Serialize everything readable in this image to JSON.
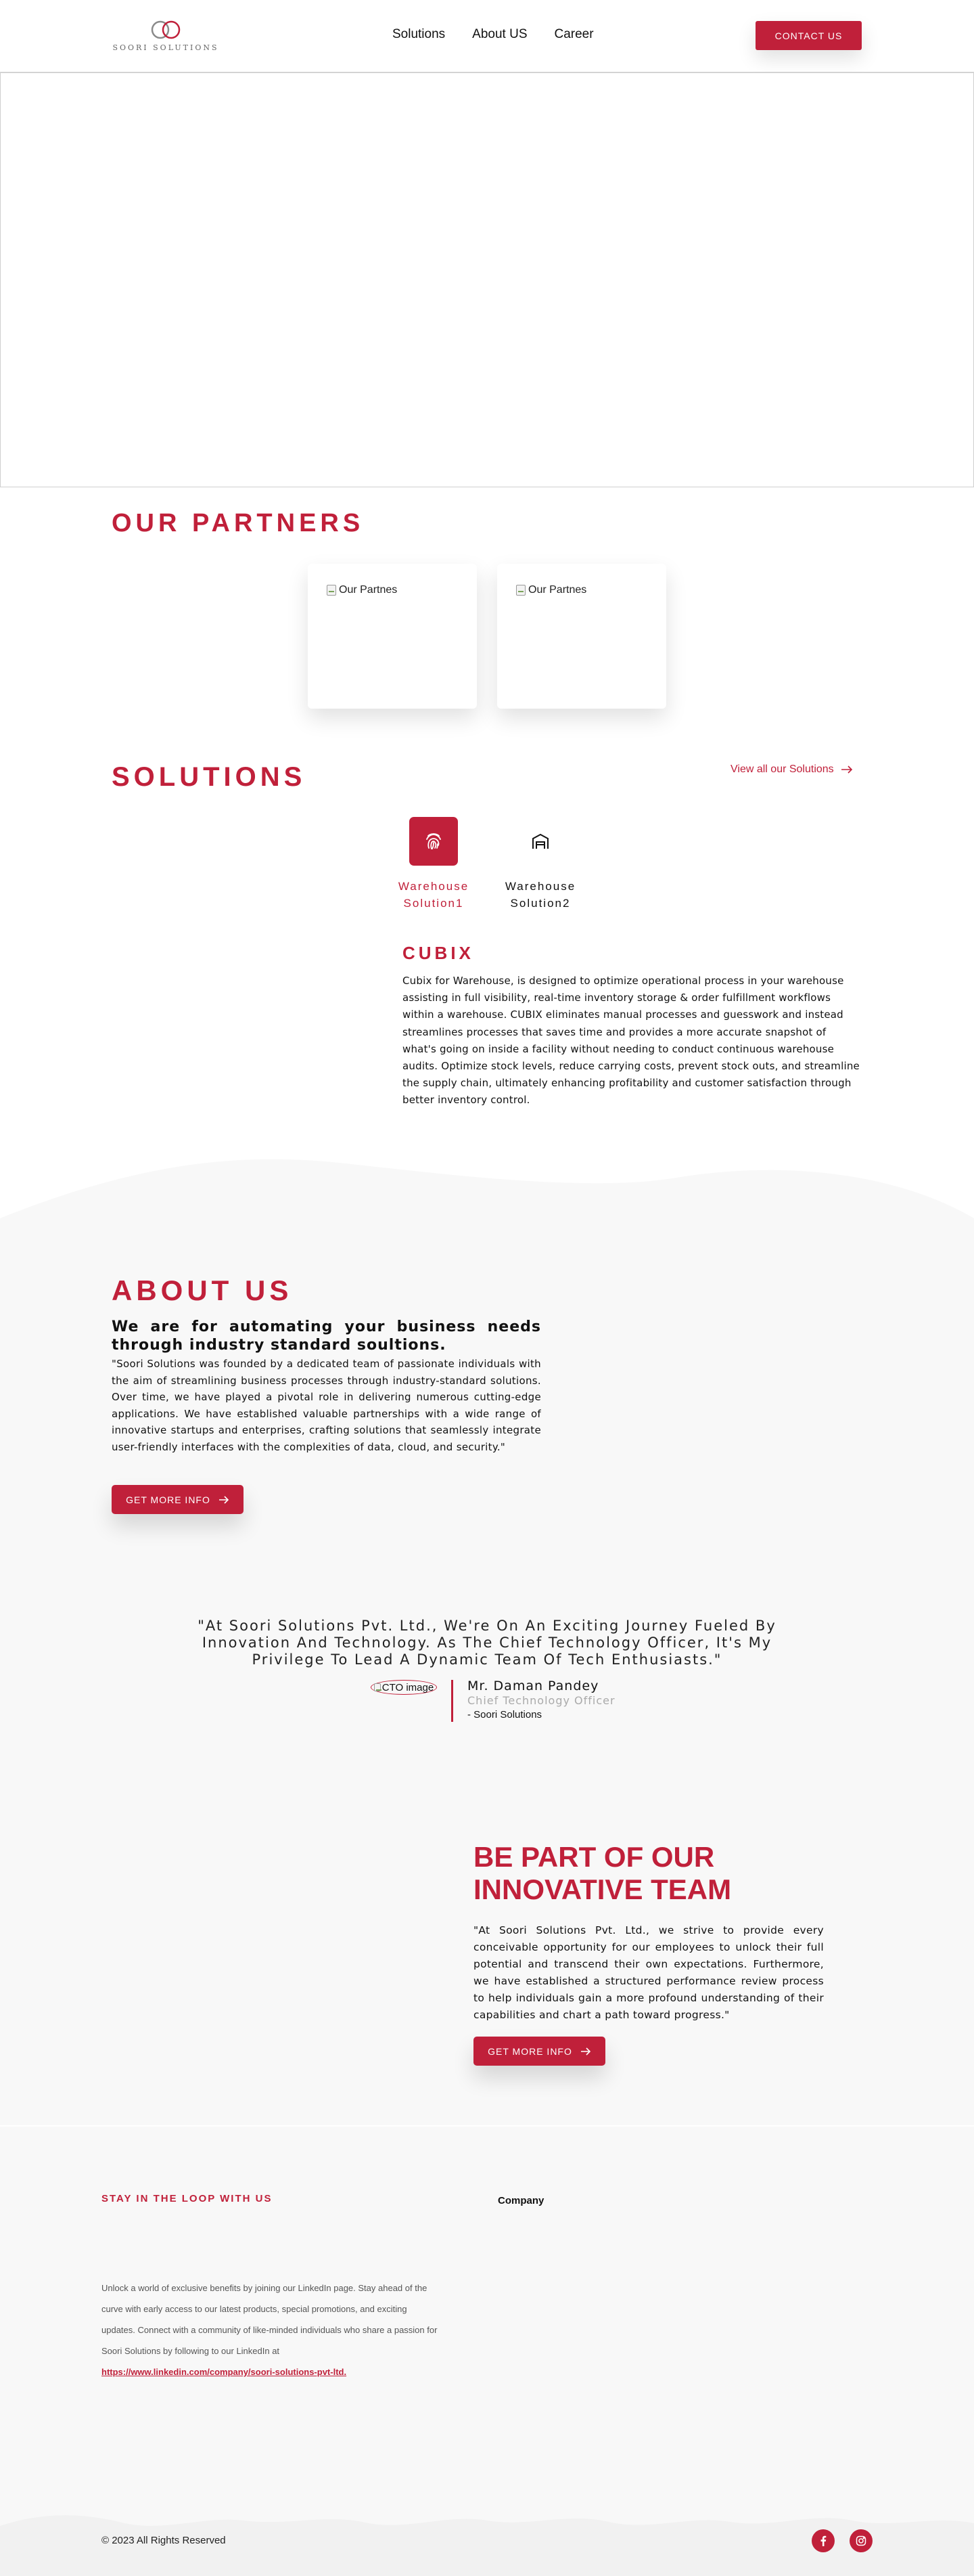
{
  "brand": {
    "name": "SOORI SOLUTIONS",
    "accent_color": "#c0203a"
  },
  "nav": {
    "items": [
      "Solutions",
      "About US",
      "Career"
    ],
    "contact_label": "CONTACT US"
  },
  "partners": {
    "title": "OUR PARTNERS",
    "cards": [
      {
        "alt": "Our Partnes"
      },
      {
        "alt": "Our Partnes"
      }
    ]
  },
  "solutions": {
    "title": "SOLUTIONS",
    "view_all": "View all our Solutions",
    "tabs": [
      {
        "line1": "Warehouse",
        "line2": "Solution1",
        "icon": "fingerprint-icon",
        "active": true
      },
      {
        "line1": "Warehouse",
        "line2": "Solution2",
        "icon": "warehouse-icon",
        "active": false
      }
    ],
    "detail": {
      "title": "CUBIX",
      "text": "Cubix for Warehouse, is designed to optimize operational process in your warehouse assisting in full visibility, real-time inventory storage & order fulfillment workflows within a warehouse. CUBIX eliminates manual processes and guesswork and instead streamlines processes that saves time and provides a more accurate snapshot of what's going on inside a facility without needing to conduct continuous warehouse audits. Optimize stock levels, reduce carrying costs, prevent stock outs, and streamline the supply chain, ultimately enhancing profitability and customer satisfaction through better inventory control."
    }
  },
  "about": {
    "title": "ABOUT US",
    "subtitle": "We are for automating your business needs through industry standard soultions.",
    "text": "\"Soori Solutions was founded by a dedicated team of passionate individuals with the aim of streamlining business processes through industry-standard solutions. Over time, we have played a pivotal role in delivering numerous cutting-edge applications. We have established valuable partnerships with a wide range of innovative startups and enterprises, crafting solutions that seamlessly integrate user-friendly interfaces with the complexities of data, cloud, and security.\"",
    "button": "GET MORE INFO"
  },
  "testimonial": {
    "quote": "\"At Soori Solutions Pvt. Ltd., We're On An Exciting Journey Fueled By Innovation And Technology. As The Chief Technology Officer, It's My Privilege To Lead A Dynamic Team Of Tech Enthusiasts.\"",
    "image_alt": "CTO image",
    "name": "Mr. Daman Pandey",
    "role": "Chief Technology Officer",
    "company": "- Soori Solutions"
  },
  "team": {
    "title": "BE PART OF OUR INNOVATIVE TEAM",
    "text": "\"At Soori Solutions Pvt. Ltd., we strive to provide every conceivable opportunity for our employees to unlock their full potential and transcend their own expectations. Furthermore, we have established a structured performance review process to help individuals gain a more profound understanding of their capabilities and chart a path toward progress.\"",
    "button": "GET MORE INFO"
  },
  "footer": {
    "heading": "STAY IN THE LOOP WITH US",
    "company_heading": "Company",
    "text": "Unlock a world of exclusive benefits by joining our LinkedIn page. Stay ahead of the curve with early access to our latest products, special promotions, and exciting updates. Connect with a community of like-minded individuals who share a passion for Soori Solutions by following to our LinkedIn at",
    "link": "https://www.linkedin.com/company/soori-solutions-pvt-ltd.",
    "copyright": "© 2023 All Rights Reserved",
    "social": [
      "facebook-icon",
      "instagram-icon"
    ]
  }
}
